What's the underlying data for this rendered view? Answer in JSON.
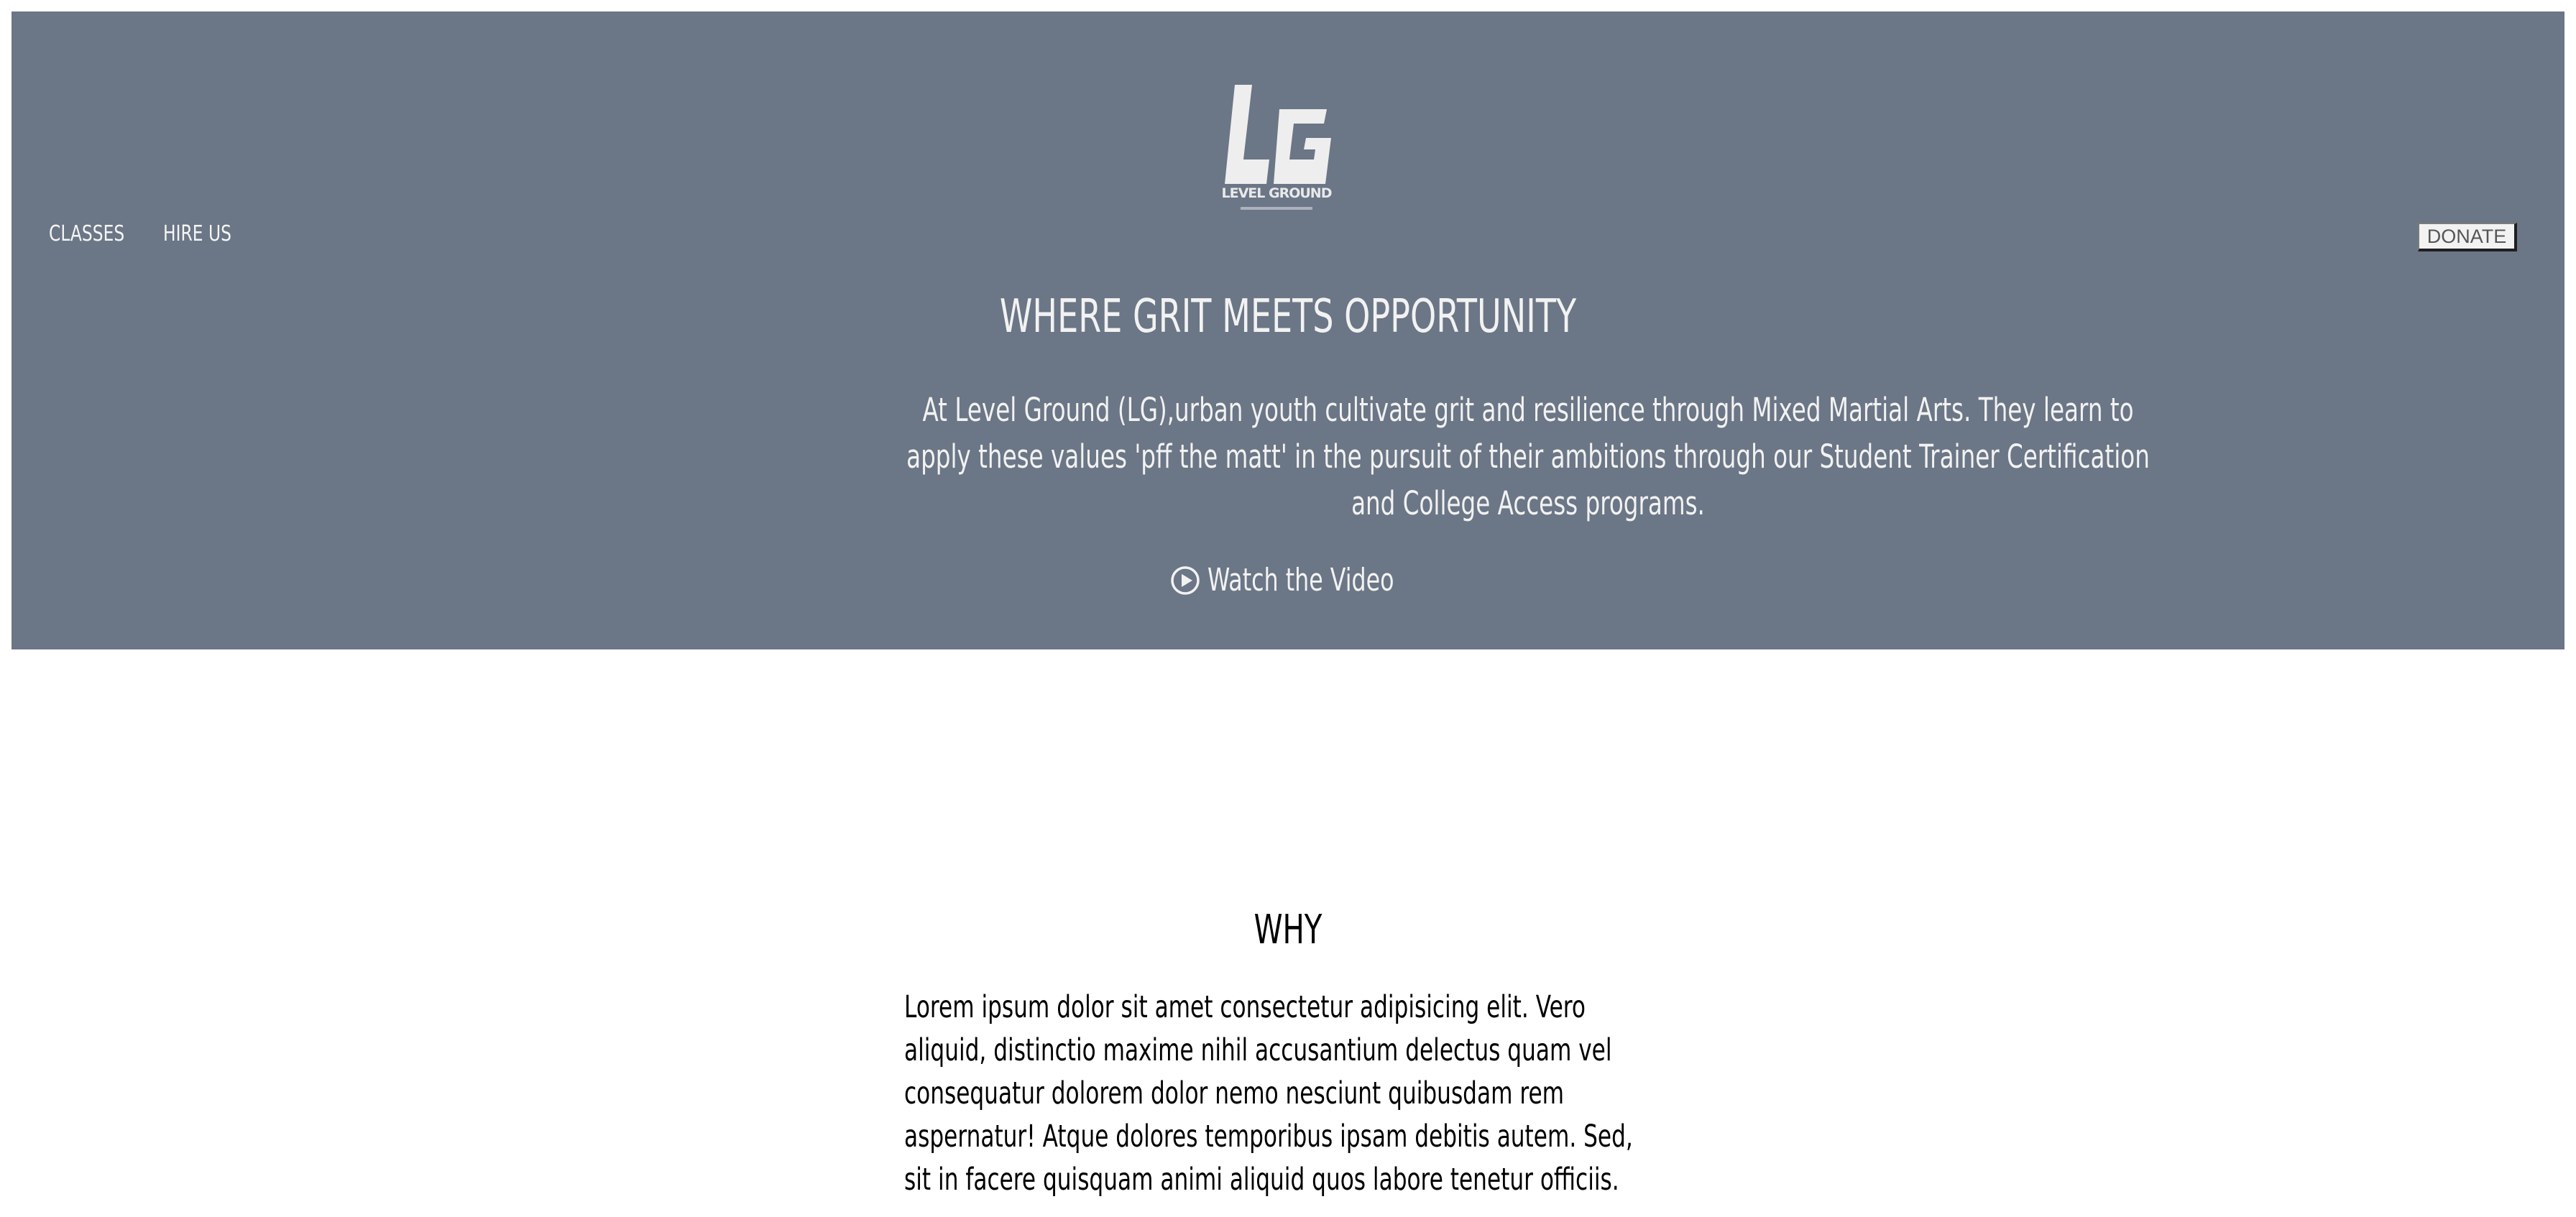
{
  "header": {
    "logo_text": "LEVEL GROUND",
    "nav": [
      {
        "label": "CLASSES"
      },
      {
        "label": "HIRE US"
      }
    ],
    "donate_label": "DONATE"
  },
  "hero": {
    "title": "WHERE GRIT MEETS OPPORTUNITY",
    "body": "At Level Ground (LG),urban youth cultivate grit and resilience through Mixed Martial Arts. They learn to apply these values 'pff the matt' in the pursuit of their ambitions through our Student Trainer Certification and College Access programs.",
    "cta_label": "Watch the Video",
    "cta_icon": "play-circle-icon",
    "background_color": "#6b7686"
  },
  "why": {
    "title": "WHY",
    "body": "Lorem ipsum dolor sit amet consectetur adipisicing elit. Vero aliquid, distinctio maxime nihil accusantium delectus quam vel consequatur dolorem dolor nemo nesciunt quibusdam rem aspernatur! Atque dolores temporibus ipsam debitis autem. Sed, sit in facere quisquam animi aliquid quos labore tenetur officiis."
  }
}
